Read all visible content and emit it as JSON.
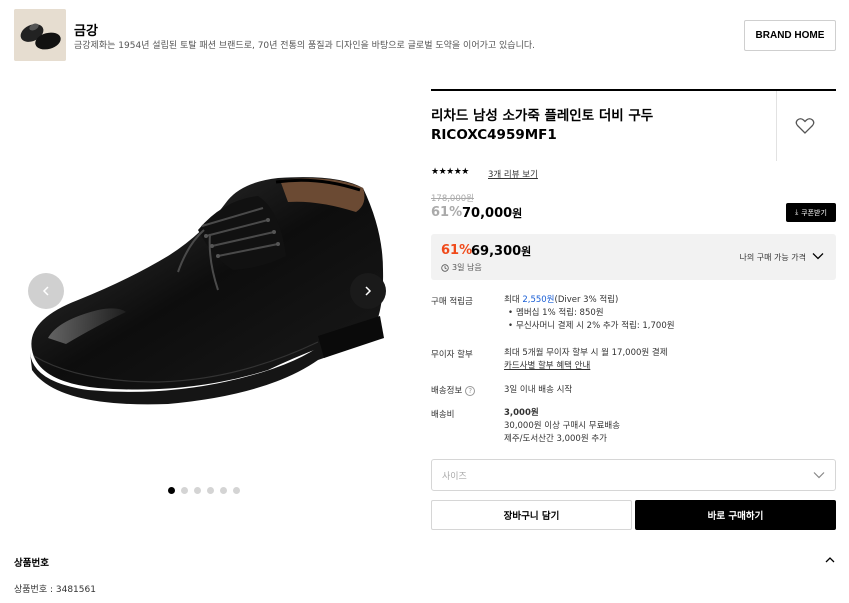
{
  "brand": {
    "name": "금강",
    "description": "금강제화는 1954년 설립된 토탈 패션 브랜드로, 70년 전통의 품질과 디자인을 바탕으로 글로벌 도약을 이어가고 있습니다.",
    "home_label": "BRAND HOME"
  },
  "gallery": {
    "image_count": 6,
    "active_index": 0
  },
  "product": {
    "title_line1": "리차드 남성 소가죽 플레인토 더비 구두",
    "title_line2": "RICOXC4959MF1",
    "rating_stars": "★★★★★",
    "rating": 5,
    "review_link": "3개 리뷰 보기",
    "original_price": "178,000원",
    "discount_rate": "61%",
    "sale_price": "70,000",
    "sale_unit": "원",
    "coupon_label": "쿠폰받기"
  },
  "my_price": {
    "rate": "61%",
    "price": "69,300",
    "unit": "원",
    "days_left": "3일 남음",
    "label": "나의 구매 가능 가격"
  },
  "info": {
    "points_label": "구매 적립금",
    "points_prefix": "최대 ",
    "points_amount": "2,550원",
    "points_suffix": "(Diver 3% 적립)",
    "points_bullet1": "멤버십 1% 적립: 850원",
    "points_bullet2": "무신사머니 결제 시 2% 추가 적립: 1,700원",
    "installment_label": "무이자 할부",
    "installment_text": "최대 5개월 무이자 할부 시 월 17,000원 결제",
    "installment_link": "카드사별 할부 혜택 안내",
    "delivery_label": "배송정보",
    "delivery_text": "3일 이내 배송 시작",
    "shipping_label": "배송비",
    "shipping_fee": "3,000원",
    "shipping_free": "30,000원 이상 구매시 무료배송",
    "shipping_extra": "제주/도서산간 3,000원 추가"
  },
  "purchase": {
    "size_placeholder": "사이즈",
    "cart_label": "장바구니 담기",
    "buy_label": "바로 구매하기"
  },
  "details": {
    "section_title": "상품번호",
    "product_number": "상품번호 : 3481561"
  },
  "colors": {
    "discount_red": "#f04a1a",
    "points_blue": "#1a5fd6"
  }
}
